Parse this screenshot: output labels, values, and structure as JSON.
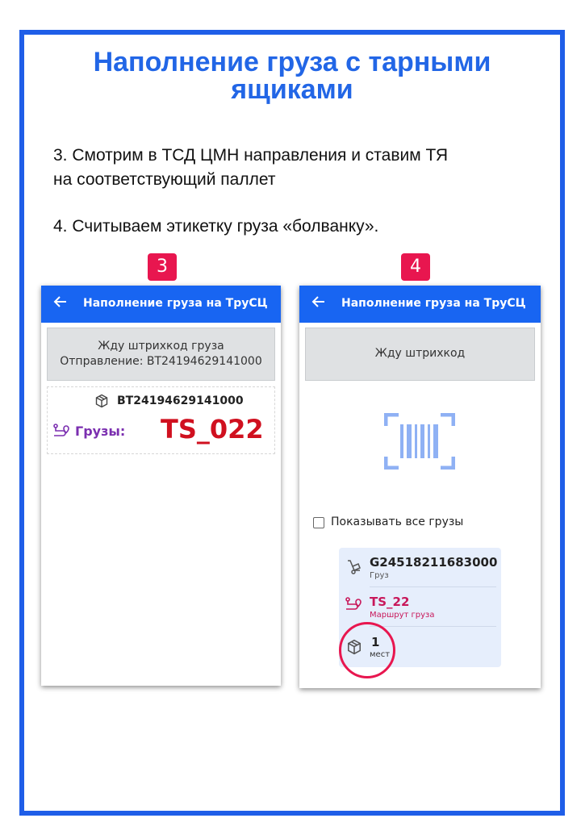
{
  "title_line1": "Наполнение груза  с тарными",
  "title_line2": "ящиками",
  "step3_line1": "3. Смотрим в ТСД ЦМН направления и ставим ТЯ",
  "step3_line2": "на соответствующий паллет",
  "step4": "4. Считываем этикетку груза «болванку».",
  "badges": {
    "left": "3",
    "right": "4"
  },
  "phone_left": {
    "back_icon": "arrow-left-icon",
    "header": "Наполнение груза на ТруСЦ",
    "scan_line1": "Жду штрихкод груза",
    "scan_line2": "Отправление: BT24194629141000",
    "shipment_icon": "box-icon",
    "shipment_code": "BT24194629141000",
    "route_icon": "route-icon",
    "cargo_label": "Грузы:",
    "cargo_value": "TS_022"
  },
  "phone_right": {
    "back_icon": "arrow-left-icon",
    "header": "Наполнение груза на ТруСЦ",
    "scan_label": "Жду штрихкод",
    "barcode_icon": "barcode-scan-icon",
    "show_all_label": "Показывать все грузы",
    "show_all_checked": false,
    "card": {
      "cargo_code": "G24518211683000",
      "cargo_caption": "Груз",
      "route_value": "TS_22",
      "route_caption": "Маршрут груза",
      "places_value": "1",
      "places_caption": "мест"
    }
  },
  "colors": {
    "accent_blue": "#1865f2",
    "title_blue": "#2266e6",
    "badge_red": "#e8164f",
    "cargo_red": "#d0101f",
    "route_pink": "#c8175a",
    "purple": "#7b2fb0"
  }
}
